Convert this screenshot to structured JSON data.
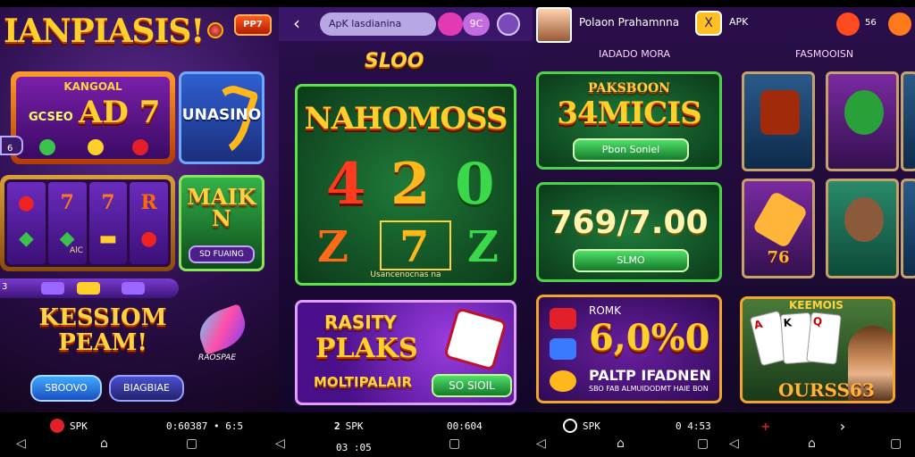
{
  "panel1": {
    "title": "IANPIASIS!",
    "top_button": "PP7",
    "machine": {
      "title": "KANGOAL",
      "big": "AD 7",
      "small": "GCSEO"
    },
    "side_bet": "6",
    "unasino_label": "UNASINO",
    "reels_label": "AlC",
    "majk": {
      "label": "MAIK N",
      "button": "SD FUAING"
    },
    "dock_label": "3",
    "kession": "KESSIOM PEAM!",
    "wing_label": "RAOSPAE",
    "pill_a": "SBOOVO",
    "pill_b": "BIAGBIAE"
  },
  "panel2": {
    "search_text": "ApK lasdianina",
    "icon2": "9C",
    "sloo": "SLOO",
    "card_title": "NAHOMOSS",
    "numbers": [
      "4",
      "2",
      "0"
    ],
    "symbols": [
      "Z",
      "7",
      "Z"
    ],
    "card_foot": "Usancenocnas na",
    "promo": {
      "line1": "RASITY",
      "line2": "PLAKS",
      "line3": "MOLTIPALAIR",
      "button": "SO SIOIL"
    }
  },
  "panel3": {
    "name": "Polaon Prahamnna",
    "x_icon": "X",
    "apk": "APK",
    "num": "56",
    "sub_left": "IADADO MORA",
    "sub_right": "FASMOOISN",
    "box1": {
      "small": "PAKSBOON",
      "big": "34MICIS",
      "button": "Pbon Soniel"
    },
    "box2": {
      "big": "769/7.00",
      "button": "SLMO"
    },
    "box3": {
      "small": "ROMK",
      "big": "6,0%0",
      "title": "PALTP IFADNEN",
      "sub": "SBO FAB ALMUIDODMT HAIE BON"
    },
    "tiles": [
      "",
      "",
      "76",
      "",
      "",
      ""
    ],
    "cards_title": "KEEMOIS",
    "cards_num": "OURSS63"
  },
  "bottom": {
    "s1": {
      "label": "SPK",
      "time": "0:60387 • 6:5"
    },
    "s2": {
      "label": "SPK",
      "time": "00:604",
      "time2": "03 :05"
    },
    "s3": {
      "label": "SPK",
      "time": "0 4:53"
    }
  }
}
